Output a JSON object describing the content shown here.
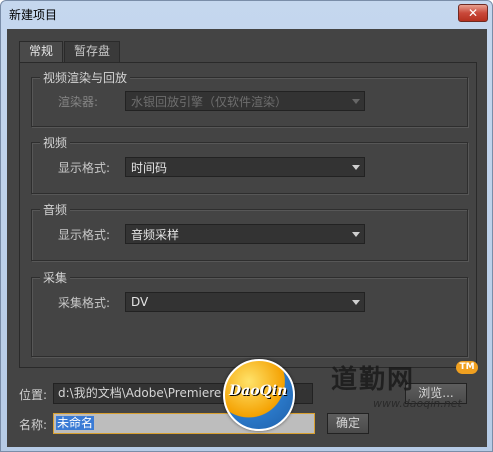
{
  "window": {
    "title": "新建项目",
    "close_glyph": "✕"
  },
  "tabs": [
    {
      "label": "常规",
      "active": true
    },
    {
      "label": "暂存盘",
      "active": false
    }
  ],
  "groups": {
    "video_render": {
      "title": "视频渲染与回放",
      "renderer_label": "渲染器:",
      "renderer_value": "水银回放引擎（仅软件渲染）",
      "disabled": true
    },
    "video": {
      "title": "视频",
      "format_label": "显示格式:",
      "format_value": "时间码"
    },
    "audio": {
      "title": "音频",
      "format_label": "显示格式:",
      "format_value": "音频采样"
    },
    "capture": {
      "title": "采集",
      "format_label": "采集格式:",
      "format_value": "DV"
    }
  },
  "location": {
    "label": "位置:",
    "path": "d:\\我的文档\\Adobe\\Premiere Pr",
    "browse_label": "浏览..."
  },
  "name": {
    "label": "名称:",
    "value": "未命名",
    "ok_label": "确定"
  },
  "watermark": {
    "badge_text": "DaoQin",
    "tm": "TM",
    "logo_text": "道勤网",
    "url": "www.daoqin.net"
  },
  "colors": {
    "background": "#444444",
    "selection": "#3a7bd5",
    "focus_border": "#d8a030"
  }
}
